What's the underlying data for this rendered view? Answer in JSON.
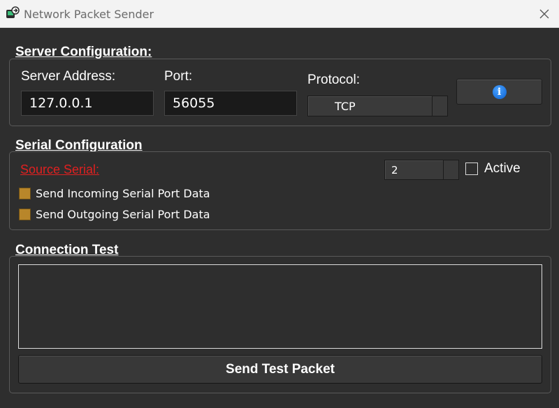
{
  "window": {
    "title": "Network Packet Sender"
  },
  "server_config": {
    "heading": "Server Configuration:",
    "address_label": "Server Address:",
    "address_value": "127.0.0.1",
    "port_label": "Port:",
    "port_value": "56055",
    "protocol_label": "Protocol:",
    "protocol_value": "TCP",
    "info_icon": "info-icon"
  },
  "serial_config": {
    "heading": "Serial Configuration",
    "source_label": "Source Serial:",
    "serial_port_value": "2",
    "active_label": "Active",
    "active_checked": false,
    "options": [
      {
        "label": "Send Incoming Serial Port Data",
        "checked": true
      },
      {
        "label": "Send Outgoing Serial Port Data",
        "checked": true
      }
    ]
  },
  "connection_test": {
    "heading": "Connection Test",
    "output_text": "",
    "send_label": "Send Test Packet"
  },
  "colors": {
    "background": "#2e2e2e",
    "link_red": "#e02020",
    "checkbox_fill": "#b8862a",
    "info_blue": "#1a73e8"
  }
}
